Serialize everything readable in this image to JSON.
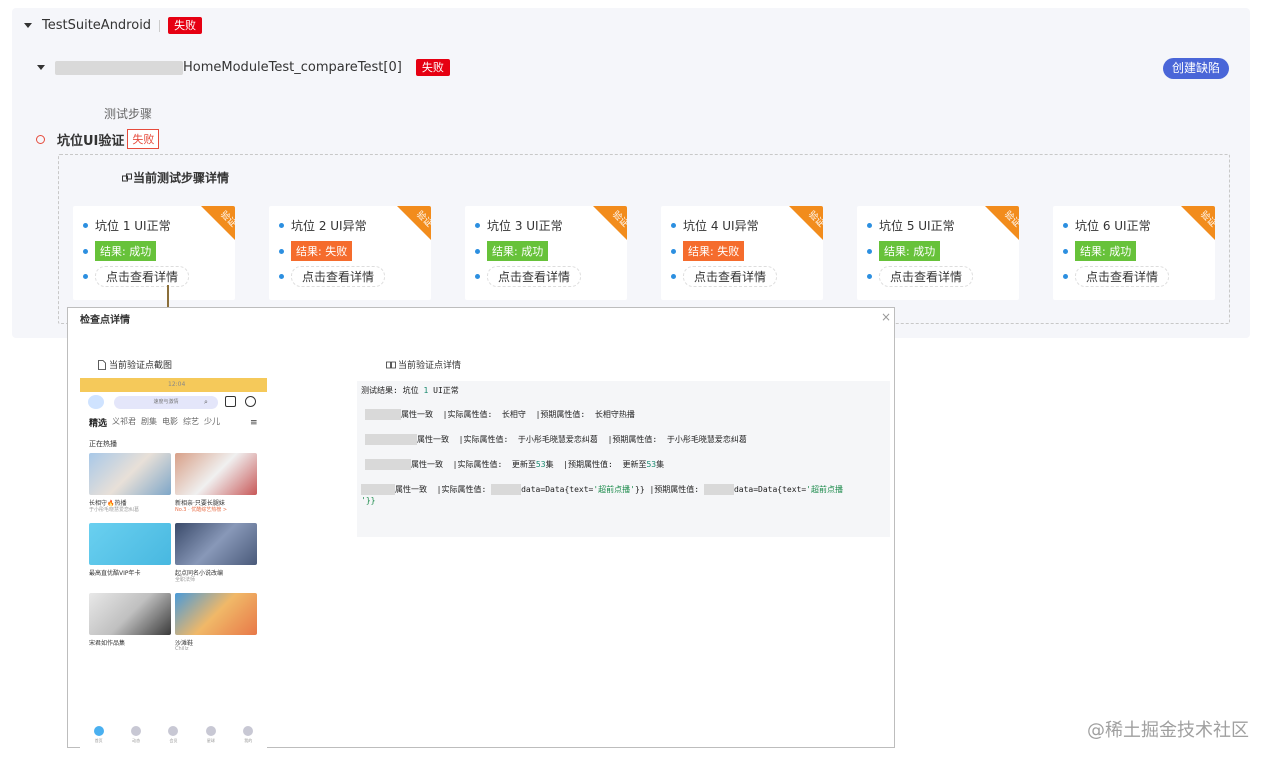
{
  "suite": {
    "name": "TestSuiteAndroid",
    "status": "失败"
  },
  "test_case": {
    "name": "HomeModuleTest_compareTest[0]",
    "status": "失败",
    "create_defect_label": "创建缺陷"
  },
  "steps": {
    "title": "测试步骤",
    "step_name": "坑位UI验证",
    "step_status": "失败",
    "detail_title": "当前测试步骤详情"
  },
  "cards": [
    {
      "title": "坑位 1 UI正常",
      "result": "结果: 成功",
      "result_type": "ok",
      "link": "点击查看详情",
      "corner": "验证"
    },
    {
      "title": "坑位 2 UI异常",
      "result": "结果: 失败",
      "result_type": "fail",
      "link": "点击查看详情",
      "corner": "验证"
    },
    {
      "title": "坑位 3 UI正常",
      "result": "结果: 成功",
      "result_type": "ok",
      "link": "点击查看详情",
      "corner": "验证"
    },
    {
      "title": "坑位 4 UI异常",
      "result": "结果: 失败",
      "result_type": "fail",
      "link": "点击查看详情",
      "corner": "验证"
    },
    {
      "title": "坑位 5 UI正常",
      "result": "结果: 成功",
      "result_type": "ok",
      "link": "点击查看详情",
      "corner": "验证"
    },
    {
      "title": "坑位 6 UI正常",
      "result": "结果: 成功",
      "result_type": "ok",
      "link": "点击查看详情",
      "corner": "验证"
    }
  ],
  "modal": {
    "title": "检查点详情",
    "close": "×",
    "screenshot_title": "当前验证点截图",
    "detail_title": "当前验证点详情",
    "phone": {
      "status_bar": "12:04",
      "search_placeholder": "速度与激情",
      "tabs": [
        "精选",
        "义祁君",
        "剧集",
        "电影",
        "综艺",
        "少儿"
      ],
      "hot_label": "正在热播",
      "items": [
        {
          "title": "长相守🔥热播",
          "sub": "于小彤毛晓慧爱恋纠葛"
        },
        {
          "title": "新相亲·只要长腿妹",
          "sub": "No.3 · 优酷综艺热榜 >"
        },
        {
          "title": "最高直优酷VIP年卡",
          "sub": ""
        },
        {
          "title": "起点同名小说改编",
          "sub": "全职法师"
        },
        {
          "title": "宋君如作品集",
          "sub": ""
        },
        {
          "title": "沙滩鞋",
          "sub": "Chillz"
        }
      ],
      "nav": [
        "首页",
        "动态",
        "会员",
        "星球",
        "我的"
      ]
    },
    "detail": {
      "result_label": "测试结果: 坑位",
      "result_num": "1",
      "result_text": "UI正常",
      "lines": [
        {
          "consistency": "属性一致",
          "actual_label": "|实际属性值:",
          "actual": "长相守",
          "expected_label": "|预期属性值:",
          "expected": "长相守热播"
        },
        {
          "consistency": "属性一致",
          "actual_label": "|实际属性值:",
          "actual": "于小彤毛晓慧爱恋纠葛",
          "expected_label": "|预期属性值:",
          "expected": "于小彤毛晓慧爱恋纠葛"
        },
        {
          "consistency": "属性一致",
          "actual_label": "|实际属性值:",
          "actual_pre": "更新至",
          "actual_num": "53",
          "actual_post": "集",
          "expected_label": "|预期属性值:",
          "expected_pre": "更新至",
          "expected_num": "53",
          "expected_post": "集"
        },
        {
          "consistency": "属性一致",
          "actual_label": "|实际属性值:",
          "actual_pre": "data=Data{text=",
          "actual_str": "'超前点播'",
          "actual_post": "}}",
          "expected_label": "|预期属性值:",
          "expected_pre": "data=Data{text=",
          "expected_str": "'超前点播",
          "expected_wrap": "'}}"
        }
      ]
    }
  },
  "watermark": "@稀土掘金技术社区",
  "colors": {
    "fail": "#e60012",
    "ok": "#67c23a",
    "fail_orange": "#f56c2d",
    "primary": "#4a66d8",
    "corner": "#f28c1c"
  }
}
